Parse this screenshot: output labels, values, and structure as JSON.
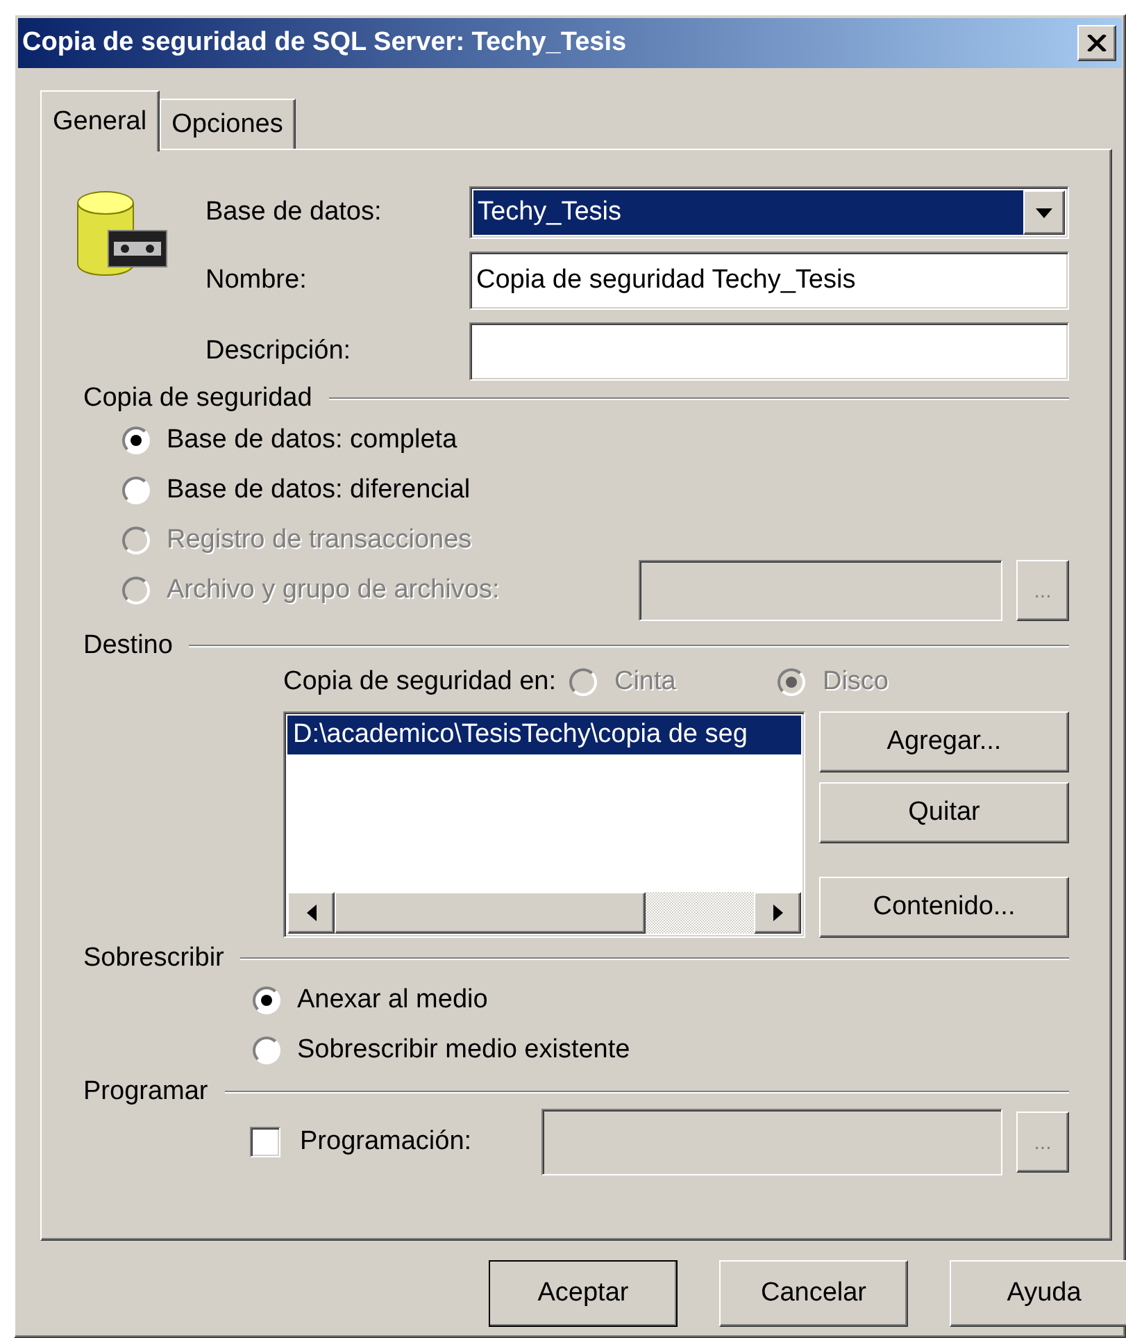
{
  "window": {
    "title": "Copia de seguridad de SQL Server: Techy_Tesis"
  },
  "tabs": [
    {
      "label": "General",
      "selected": true
    },
    {
      "label": "Opciones",
      "selected": false
    }
  ],
  "fields": [
    {
      "kind": "combo",
      "label": "Base de datos:",
      "value": "Techy_Tesis"
    },
    {
      "kind": "text",
      "label": "Nombre:",
      "value": "Copia de seguridad Techy_Tesis"
    },
    {
      "kind": "text",
      "label": "Descripción:"
    }
  ],
  "backup_type": {
    "title": "Copia de seguridad",
    "options": [
      {
        "kind": "plain",
        "label": "Base de datos: completa",
        "selected": true,
        "disabled": false
      },
      {
        "kind": "plain",
        "label": "Base de datos: diferencial",
        "selected": false,
        "disabled": false
      },
      {
        "kind": "plain",
        "label": "Registro de transacciones",
        "selected": false,
        "disabled": true
      },
      {
        "kind": "with_field",
        "label": "Archivo y grupo de archivos:",
        "selected": false,
        "disabled": true,
        "browse_button": "..."
      }
    ]
  },
  "destination": {
    "title": "Destino",
    "media_label": "Copia de seguridad en:",
    "media": [
      {
        "label": "Cinta",
        "selected": false,
        "disabled": true
      },
      {
        "label": "Disco",
        "selected": true,
        "disabled": true
      }
    ],
    "paths": [
      {
        "text": "D:\\academico\\TesisTechy\\copia de seg",
        "selected": true
      }
    ],
    "buttons": [
      "Agregar...",
      "Quitar",
      "Contenido..."
    ]
  },
  "overwrite": {
    "title": "Sobrescribir",
    "options": [
      {
        "label": "Anexar al medio",
        "selected": true,
        "disabled": false
      },
      {
        "label": "Sobrescribir medio existente",
        "selected": false,
        "disabled": false
      }
    ]
  },
  "schedule": {
    "title": "Programar",
    "checkbox": {
      "label": "Programación:",
      "checked": false
    },
    "browse_button": "..."
  },
  "buttons": [
    {
      "label": "Aceptar",
      "default": true
    },
    {
      "label": "Cancelar",
      "default": false
    },
    {
      "label": "Ayuda",
      "default": false
    }
  ]
}
